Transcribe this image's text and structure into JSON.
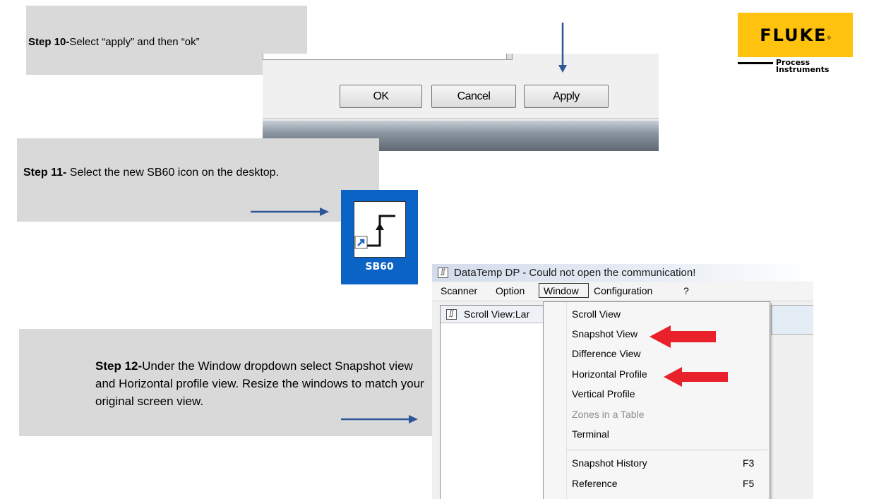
{
  "step10": {
    "bold": "Step 10-",
    "text": "Select “apply” and then “ok”"
  },
  "step11": {
    "bold": "Step 11-",
    "text": " Select the new SB60 icon on the desktop."
  },
  "step12": {
    "bold": "Step 12-",
    "text": "Under the Window dropdown select Snapshot view and Horizontal profile view. Resize the windows to match your original screen view."
  },
  "dialog": {
    "ok": "OK",
    "cancel": "Cancel",
    "apply": "Apply"
  },
  "logo": {
    "word": "FLUKE",
    "trademark": "®",
    "line1": "Process",
    "line2": "Instruments",
    "brand_color": "#ffc20e"
  },
  "desktop_icon": {
    "label": "SB60",
    "tile_color": "#0b63c6"
  },
  "app": {
    "title": "DataTemp DP - Could not open the communication!",
    "menu": [
      "Scanner",
      "Option",
      "Window",
      "Configuration",
      "?"
    ],
    "child_window_title": "Scroll View:Lar",
    "window_menu": [
      {
        "label": "Scroll View",
        "key": ""
      },
      {
        "label": "Snapshot View",
        "key": ""
      },
      {
        "label": "Difference View",
        "key": ""
      },
      {
        "label": "Horizontal Profile",
        "key": ""
      },
      {
        "label": "Vertical Profile",
        "key": ""
      },
      {
        "label": "Zones in a Table",
        "key": "",
        "disabled": true
      },
      {
        "label": "Terminal",
        "key": ""
      },
      {
        "label": "Snapshot History",
        "key": "F3"
      },
      {
        "label": "Reference",
        "key": "F5"
      }
    ]
  },
  "colors": {
    "callout": "#d9d9d9",
    "pointer_arrow": "#2e5597",
    "highlight_arrow": "#e8212a"
  },
  "icons": [
    "down-arrow-icon",
    "right-arrow-icon",
    "red-arrow-icon",
    "shortcut-arrow-icon",
    "app-window-icon"
  ]
}
